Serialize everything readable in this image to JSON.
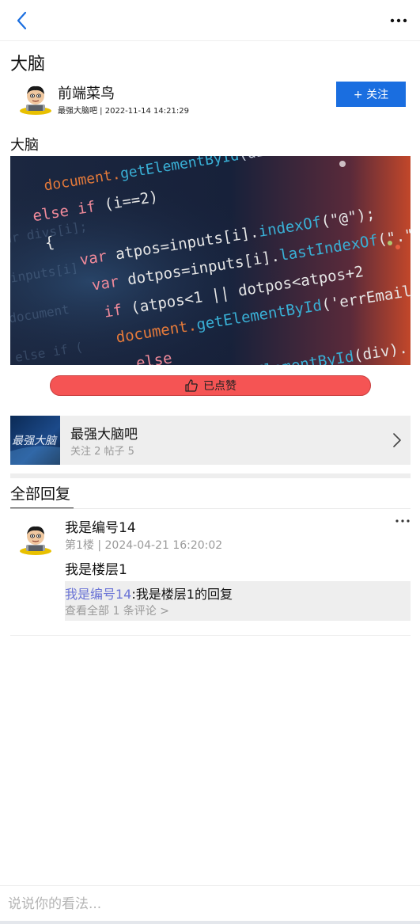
{
  "post": {
    "title": "大脑",
    "author": "前端菜鸟",
    "meta": "最强大脑吧 | 2022-11-14 14:21:29",
    "follow_label": "+ 关注",
    "content": "大脑",
    "like_label": "已点赞"
  },
  "forum": {
    "name": "最强大脑吧",
    "stats": "关注 2 帖子 5",
    "thumb_text": "最强大脑"
  },
  "replies": {
    "tab_label": "全部回复",
    "items": [
      {
        "user": "我是编号14",
        "meta": "第1楼 | 2024-04-21 16:20:02",
        "body": "我是楼层1",
        "sub_author": "我是编号14",
        "sub_text": ":我是楼层1的回复",
        "view_all": "查看全部 1 条评论 >"
      }
    ]
  },
  "comment": {
    "placeholder": "说说你的看法..."
  },
  "icons": {
    "back": "chevron-left-icon",
    "more": "more-horizontal-icon",
    "like": "thumbs-up-icon",
    "forum_arrow": "chevron-right-icon"
  },
  "colors": {
    "accent": "#1a6ee0",
    "like": "#f55454",
    "link": "#6b74d6",
    "muted": "#9a9a9a"
  }
}
